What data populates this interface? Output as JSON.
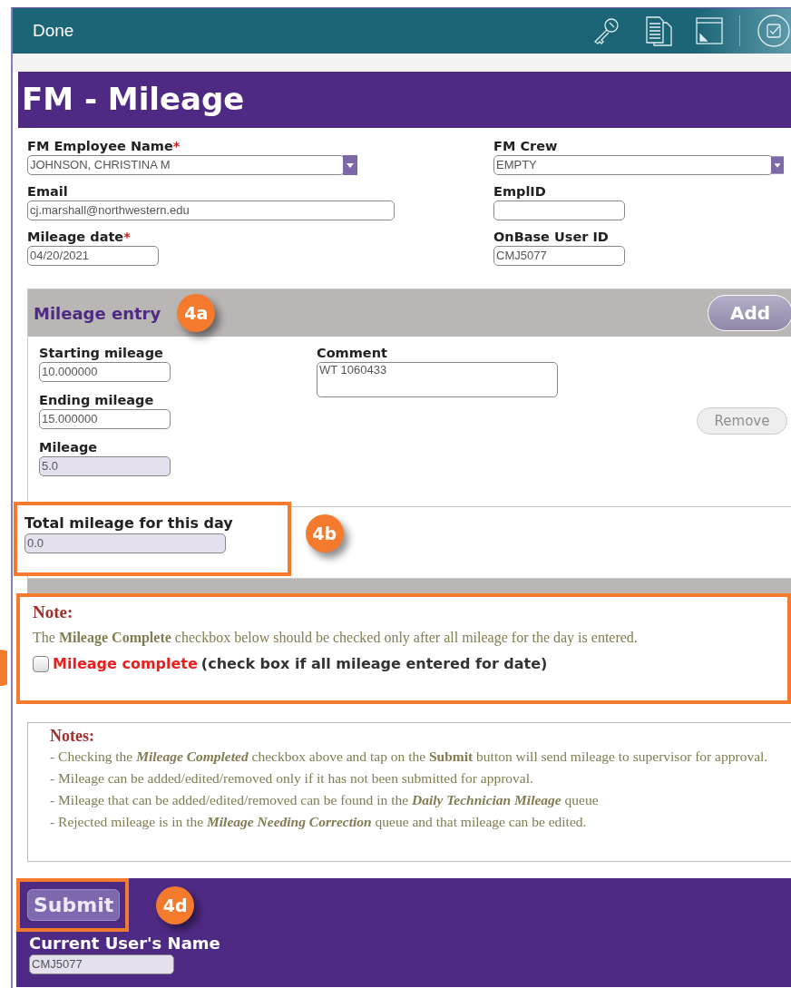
{
  "toolbar": {
    "done_label": "Done"
  },
  "form": {
    "title": "FM - Mileage",
    "left_fields": [
      {
        "label": "FM Employee Name",
        "required_mark": "*",
        "value": "JOHNSON, CHRISTINA M",
        "kind": "select"
      },
      {
        "label": "Email",
        "value": "cj.marshall@northwestern.edu",
        "kind": "wide"
      },
      {
        "label": "Mileage date",
        "required_mark": "*",
        "value": "04/20/2021",
        "kind": "short"
      }
    ],
    "right_fields": [
      {
        "label": "FM Crew",
        "value": "EMPTY",
        "kind": "select"
      },
      {
        "label": "EmplID",
        "kind": "short"
      },
      {
        "label": "OnBase User ID",
        "value": "CMJ5077",
        "kind": "short"
      }
    ]
  },
  "mileage_entry": {
    "title": "Mileage entry",
    "badge": "4a",
    "add_label": "Add",
    "remove": {
      "label": "Remove",
      "disabled": true
    },
    "fields": [
      {
        "label": "Starting mileage",
        "value": "10.000000",
        "readonly": false
      },
      {
        "label": "Ending mileage",
        "value": "15.000000",
        "readonly": false
      },
      {
        "label": "Mileage",
        "value": "5.0",
        "readonly": true
      }
    ],
    "comment": {
      "label": "Comment",
      "value": "WT 1060433"
    }
  },
  "total": {
    "label": "Total mileage for this day",
    "value": "0.0",
    "badge": "4b"
  },
  "note": {
    "title": "Note:",
    "text": "The **Mileage Complete** checkbox below should be checked only after all mileage for the day is entered.",
    "checkbox": {
      "checked": false,
      "label_emphasis": "Mileage complete",
      "label_rest": "(check box if all mileage entered for date)"
    }
  },
  "notes": {
    "title": "Notes:",
    "lines": [
      "- Checking the *Mileage Completed* checkbox above and tap on the **Submit** button will send mileage to supervisor for approval.",
      "- Mileage can be added/edited/removed only if it has not been submitted for approval.",
      "- Mileage that can be added/edited/removed can be found in the *Daily Technician Mileage* queue",
      "- Rejected mileage is in the *Mileage Needing Correction* queue and that mileage can be edited."
    ]
  },
  "footer": {
    "submit_label": "Submit",
    "badge": "4d",
    "current_user": {
      "label": "Current User's Name",
      "value": "CMJ5077"
    }
  }
}
